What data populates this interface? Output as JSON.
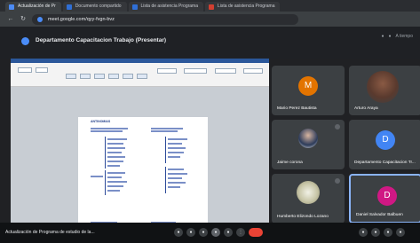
{
  "browser": {
    "tabs": [
      {
        "label": "Actualización de Pr",
        "favicon": "meet"
      },
      {
        "label": "Documento compartido",
        "favicon": "doc"
      },
      {
        "label": "Lista de asistencia Programa",
        "favicon": "doc"
      },
      {
        "label": "Lista de asistencia Programa",
        "favicon": "red"
      }
    ],
    "url": "meet.google.com/qyy-fvgn-bvz"
  },
  "meet": {
    "title": "Departamento Capacitacion Trabajo (Presentar)",
    "header_icons": [
      "people-icon",
      "chat-icon",
      "info-icon"
    ],
    "header_text": "A tiempo"
  },
  "presentation": {
    "doc_heading": "ANTINOMIAS"
  },
  "participants": [
    {
      "name": "Mario Perez Bautista",
      "initial": "M",
      "color": "#e37400"
    },
    {
      "name": "Arturo Araya",
      "initial": "",
      "color": "#6d4c41"
    },
    {
      "name": "Jaime corona",
      "initial": "",
      "color": "#4a4a4a"
    },
    {
      "name": "Departamento Capacitacion Tr...",
      "initial": "D",
      "color": "#4285f4"
    },
    {
      "name": "Humberto Elizondo Lozano",
      "initial": "",
      "color": "#8d8b6d"
    },
    {
      "name": "Daniel Salvador Balbuen",
      "initial": "D",
      "color": "#d01884"
    }
  ],
  "bottom": {
    "details": "Actualización de Programa de estudio de la..."
  }
}
